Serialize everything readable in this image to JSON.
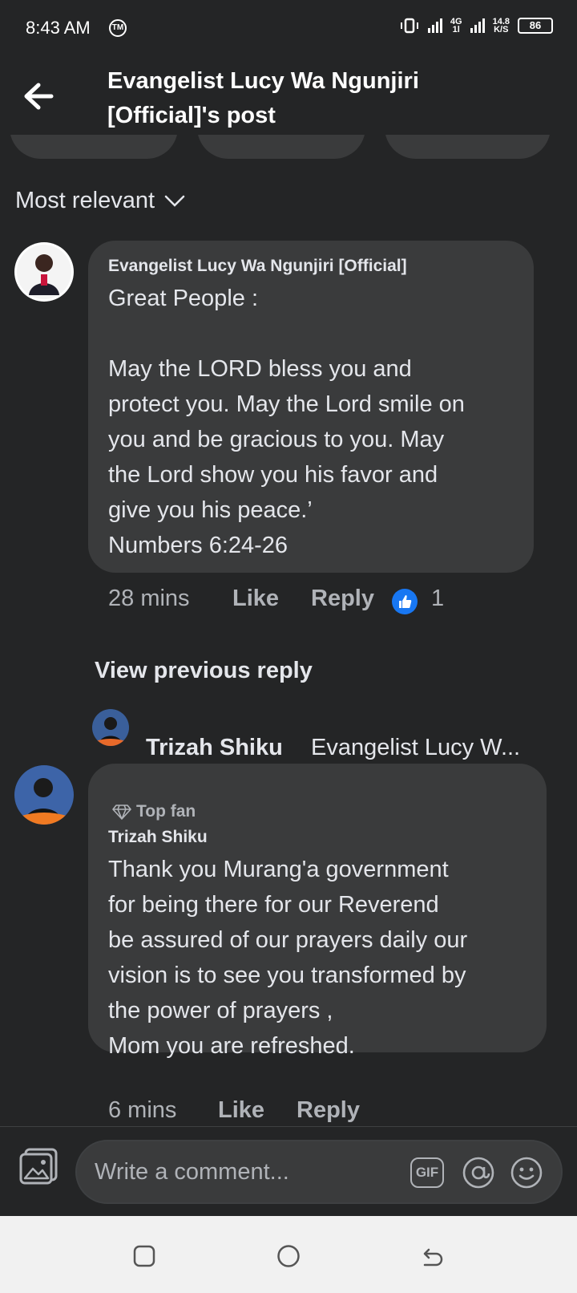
{
  "status_bar": {
    "time": "8:43 AM",
    "app_icon": "TM",
    "network_type": "4G",
    "network_sub": "1l",
    "speed_value": "14.8",
    "speed_unit": "K/S",
    "battery": "86"
  },
  "header": {
    "title": "Evangelist Lucy Wa Ngunjiri [Official]'s post",
    "back_icon": "arrow-left-icon"
  },
  "sort": {
    "label": "Most relevant"
  },
  "comments": [
    {
      "author": "Evangelist Lucy Wa Ngunjiri [Official]",
      "text": "Great People :\n\nMay the LORD bless you and\nprotect you. May the Lord smile on\nyou and be gracious to you. May\nthe Lord show you his favor and\ngive you his peace.’\nNumbers 6:24-26",
      "time": "28 mins",
      "like_label": "Like",
      "reply_label": "Reply",
      "reaction_count": "1"
    },
    {
      "badge": "Top fan",
      "author": "Trizah Shiku",
      "text": "Thank you  Murang'a  government\nfor being  there for our Reverend\nbe assured of our prayers  daily  our\nvision is to see you transformed  by\nthe power of prayers ,\nMom you are refreshed.",
      "time": "6 mins",
      "like_label": "Like",
      "reply_label": "Reply"
    }
  ],
  "view_previous": "View previous reply",
  "reply_preview": {
    "author": "Trizah Shiku",
    "mention": "Evangelist Lucy W..."
  },
  "composer": {
    "placeholder": "Write a comment...",
    "gif_label": "GIF"
  },
  "colors": {
    "background": "#242526",
    "bubble": "#3a3b3c",
    "text": "#e4e6eb",
    "muted": "#b0b3b8",
    "accent": "#1877f2"
  }
}
